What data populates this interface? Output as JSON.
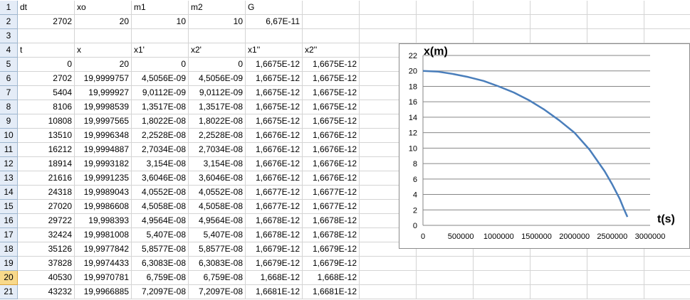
{
  "columns": [
    {
      "key": "A",
      "width": 80
    },
    {
      "key": "B",
      "width": 80
    },
    {
      "key": "C",
      "width": 80
    },
    {
      "key": "D",
      "width": 80
    },
    {
      "key": "E",
      "width": 80
    },
    {
      "key": "F",
      "width": 80
    },
    {
      "key": "G",
      "width": 80
    },
    {
      "key": "H",
      "width": 80
    },
    {
      "key": "I",
      "width": 80
    },
    {
      "key": "J",
      "width": 80
    },
    {
      "key": "K",
      "width": 80
    },
    {
      "key": "L",
      "width": 80
    }
  ],
  "active_row": "20",
  "rows": [
    {
      "n": "1",
      "cells": [
        "dt",
        "",
        "xo",
        "",
        "m1",
        "",
        "m2",
        "",
        "G",
        "",
        "",
        ""
      ],
      "align": [
        "txt",
        "txt",
        "txt",
        "txt",
        "txt",
        "txt",
        "txt",
        "txt",
        "txt",
        "txt",
        "txt",
        "txt"
      ]
    },
    {
      "n": "2",
      "cells": [
        "",
        "2702",
        "",
        "20",
        "",
        "10",
        "",
        "10",
        "",
        "6,67E-11",
        "",
        ""
      ],
      "align": [
        "num",
        "num",
        "num",
        "num",
        "num",
        "num",
        "num",
        "num",
        "num",
        "num",
        "num",
        "num"
      ]
    },
    {
      "n": "3",
      "cells": [
        "",
        "",
        "",
        "",
        "",
        "",
        "",
        "",
        "",
        "",
        "",
        ""
      ],
      "align": [
        "txt",
        "txt",
        "txt",
        "txt",
        "txt",
        "txt",
        "txt",
        "txt",
        "txt",
        "txt",
        "txt",
        "txt"
      ]
    },
    {
      "n": "4",
      "cells": [
        "t",
        "",
        "x",
        "",
        "x1'",
        "",
        "x2'",
        "",
        "x1''",
        "",
        "x2''",
        ""
      ],
      "align": [
        "txt",
        "txt",
        "txt",
        "txt",
        "txt",
        "txt",
        "txt",
        "txt",
        "txt",
        "txt",
        "txt",
        "txt"
      ]
    },
    {
      "n": "5",
      "cells": [
        "",
        "0",
        "",
        "20",
        "",
        "0",
        "",
        "0",
        "",
        "1,6675E-12",
        "",
        "1,6675E-12"
      ]
    },
    {
      "n": "6",
      "cells": [
        "",
        "2702",
        "",
        "19,9999757",
        "",
        "4,5056E-09",
        "",
        "4,5056E-09",
        "",
        "1,6675E-12",
        "",
        "1,6675E-12"
      ]
    },
    {
      "n": "7",
      "cells": [
        "",
        "5404",
        "",
        "19,999927",
        "",
        "9,0112E-09",
        "",
        "9,0112E-09",
        "",
        "1,6675E-12",
        "",
        "1,6675E-12"
      ]
    },
    {
      "n": "8",
      "cells": [
        "",
        "8106",
        "",
        "19,9998539",
        "",
        "1,3517E-08",
        "",
        "1,3517E-08",
        "",
        "1,6675E-12",
        "",
        "1,6675E-12"
      ]
    },
    {
      "n": "9",
      "cells": [
        "",
        "10808",
        "",
        "19,9997565",
        "",
        "1,8022E-08",
        "",
        "1,8022E-08",
        "",
        "1,6675E-12",
        "",
        "1,6675E-12"
      ]
    },
    {
      "n": "10",
      "cells": [
        "",
        "13510",
        "",
        "19,9996348",
        "",
        "2,2528E-08",
        "",
        "2,2528E-08",
        "",
        "1,6676E-12",
        "",
        "1,6676E-12"
      ]
    },
    {
      "n": "11",
      "cells": [
        "",
        "16212",
        "",
        "19,9994887",
        "",
        "2,7034E-08",
        "",
        "2,7034E-08",
        "",
        "1,6676E-12",
        "",
        "1,6676E-12"
      ]
    },
    {
      "n": "12",
      "cells": [
        "",
        "18914",
        "",
        "19,9993182",
        "",
        "3,154E-08",
        "",
        "3,154E-08",
        "",
        "1,6676E-12",
        "",
        "1,6676E-12"
      ]
    },
    {
      "n": "13",
      "cells": [
        "",
        "21616",
        "",
        "19,9991235",
        "",
        "3,6046E-08",
        "",
        "3,6046E-08",
        "",
        "1,6676E-12",
        "",
        "1,6676E-12"
      ]
    },
    {
      "n": "14",
      "cells": [
        "",
        "24318",
        "",
        "19,9989043",
        "",
        "4,0552E-08",
        "",
        "4,0552E-08",
        "",
        "1,6677E-12",
        "",
        "1,6677E-12"
      ]
    },
    {
      "n": "15",
      "cells": [
        "",
        "27020",
        "",
        "19,9986608",
        "",
        "4,5058E-08",
        "",
        "4,5058E-08",
        "",
        "1,6677E-12",
        "",
        "1,6677E-12"
      ]
    },
    {
      "n": "16",
      "cells": [
        "",
        "29722",
        "",
        "19,998393",
        "",
        "4,9564E-08",
        "",
        "4,9564E-08",
        "",
        "1,6678E-12",
        "",
        "1,6678E-12"
      ]
    },
    {
      "n": "17",
      "cells": [
        "",
        "32424",
        "",
        "19,9981008",
        "",
        "5,407E-08",
        "",
        "5,407E-08",
        "",
        "1,6678E-12",
        "",
        "1,6678E-12"
      ]
    },
    {
      "n": "18",
      "cells": [
        "",
        "35126",
        "",
        "19,9977842",
        "",
        "5,8577E-08",
        "",
        "5,8577E-08",
        "",
        "1,6679E-12",
        "",
        "1,6679E-12"
      ]
    },
    {
      "n": "19",
      "cells": [
        "",
        "37828",
        "",
        "19,9974433",
        "",
        "6,3083E-08",
        "",
        "6,3083E-08",
        "",
        "1,6679E-12",
        "",
        "1,6679E-12"
      ]
    },
    {
      "n": "20",
      "cells": [
        "",
        "40530",
        "",
        "19,9970781",
        "",
        "6,759E-08",
        "",
        "6,759E-08",
        "",
        "1,668E-12",
        "",
        "1,668E-12"
      ]
    },
    {
      "n": "21",
      "cells": [
        "",
        "43232",
        "",
        "19,9966885",
        "",
        "7,2097E-08",
        "",
        "7,2097E-08",
        "",
        "1,6681E-12",
        "",
        "1,6681E-12"
      ]
    }
  ],
  "chart_data": {
    "type": "line",
    "title": "",
    "xlabel": "t(s)",
    "ylabel": "x(m)",
    "xlim": [
      0,
      3000000
    ],
    "ylim": [
      0,
      22
    ],
    "xticks": [
      0,
      500000,
      1000000,
      1500000,
      2000000,
      2500000,
      3000000
    ],
    "yticks": [
      0,
      2,
      4,
      6,
      8,
      10,
      12,
      14,
      16,
      18,
      20,
      22
    ],
    "xtick_labels": [
      "0",
      "500000",
      "1000000",
      "1500000",
      "2000000",
      "2500000",
      "3000000"
    ],
    "ytick_labels": [
      "0",
      "2",
      "4",
      "6",
      "8",
      "10",
      "12",
      "14",
      "16",
      "18",
      "20",
      "22"
    ],
    "grid": "horizontal",
    "series": [
      {
        "color": "#4a7ebb",
        "x": [
          0,
          200000,
          400000,
          600000,
          800000,
          1000000,
          1200000,
          1400000,
          1600000,
          1800000,
          2000000,
          2200000,
          2400000,
          2500000,
          2600000,
          2650000,
          2700000
        ],
        "y": [
          20,
          19.9,
          19.6,
          19.2,
          18.7,
          18.0,
          17.2,
          16.2,
          15.0,
          13.6,
          12.0,
          9.8,
          7.0,
          5.3,
          3.4,
          2.2,
          1.1
        ]
      }
    ]
  }
}
